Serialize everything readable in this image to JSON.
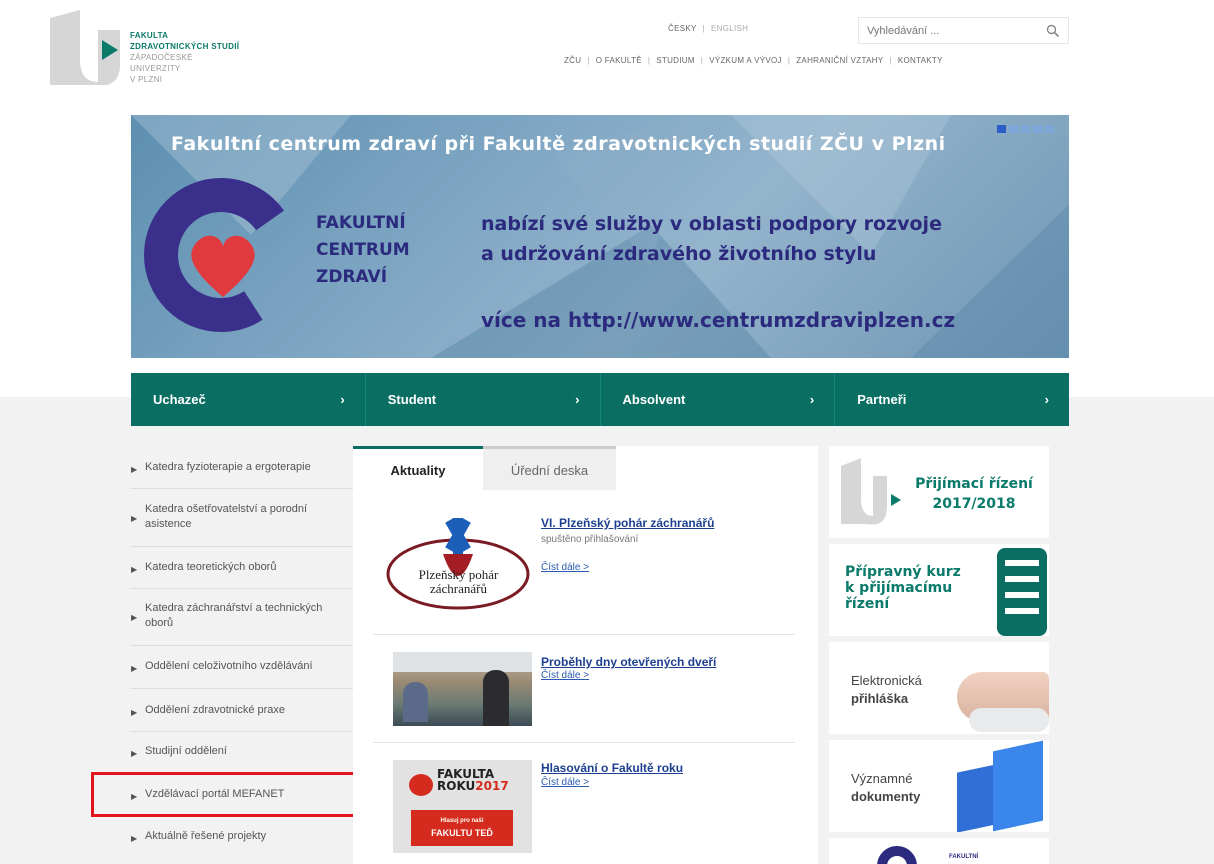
{
  "header": {
    "logo_text": [
      "FAKULTA",
      "ZDRAVOTNICKÝCH STUDIÍ",
      "ZÁPADOČESKÉ",
      "UNIVERZITY",
      "V PLZNI"
    ],
    "lang_cz": "ČESKY",
    "lang_en": "ENGLISH",
    "search_placeholder": "Vyhledávání ...",
    "nav": [
      "ZČU",
      "O FAKULTĚ",
      "STUDIUM",
      "VÝZKUM A VÝVOJ",
      "ZAHRANIČNÍ VZTAHY",
      "KONTAKTY"
    ]
  },
  "banner": {
    "title": "Fakultní centrum zdraví při Fakultě zdravotnických studií ZČU v Plzni",
    "logo_words": [
      "FAKULTNÍ",
      "CENTRUM",
      "ZDRAVÍ"
    ],
    "line1": "nabízí své služby v oblasti podpory rozvoje",
    "line2": "a udržování zdravého životního stylu",
    "line3": "více na http://www.centrumzdraviplzen.cz"
  },
  "mainnav": [
    {
      "label": "Uchazeč",
      "chev": "›"
    },
    {
      "label": "Student",
      "chev": "›"
    },
    {
      "label": "Absolvent",
      "chev": "›"
    },
    {
      "label": "Partneři",
      "chev": "›"
    }
  ],
  "sidebar": {
    "items": [
      "Katedra fyzioterapie a ergoterapie",
      "Katedra ošetřovatelství a porodní asistence",
      "Katedra teoretických oborů",
      "Katedra záchranářství a technických oborů",
      "Oddělení celoživotního vzdělávání",
      "Oddělení zdravotnické praxe",
      "Studijní oddělení",
      "Vzdělávací portál MEFANET",
      "Aktuálně řešené projekty"
    ]
  },
  "tabs": {
    "active": "Aktuality",
    "inactive": "Úřední deska"
  },
  "news": [
    {
      "title": "VI. Plzeňský pohár záchranářů",
      "sub": "spuštěno přihlašování",
      "more": "Číst dále >",
      "img_text1": "Plzeňský pohár",
      "img_text2": "záchranářů"
    },
    {
      "title": "Proběhly dny otevřených dveří",
      "more": "Číst dále >"
    },
    {
      "title": "Hlasování o Fakultě roku",
      "more": "Číst dále >",
      "img_text1": "FAKULTA",
      "img_text2": "ROKU",
      "img_year": "2017",
      "img_text3": "Hlasuj pro naši",
      "img_text4": "FAKULTU TEĎ"
    }
  ],
  "cards": {
    "admission1": "Přijímací řízení",
    "admission2": "2017/2018",
    "prep1": "Přípravný kurz",
    "prep2": "k přijímacímu",
    "prep3": "řízení",
    "app1": "Elektronická",
    "app2": "přihláška",
    "docs1": "Významné",
    "docs2": "dokumenty",
    "last": "FAKULTNÍ"
  },
  "colors": {
    "brand": "#0b6e63",
    "link": "#1d3f8f",
    "highlight": "#e4141e"
  }
}
